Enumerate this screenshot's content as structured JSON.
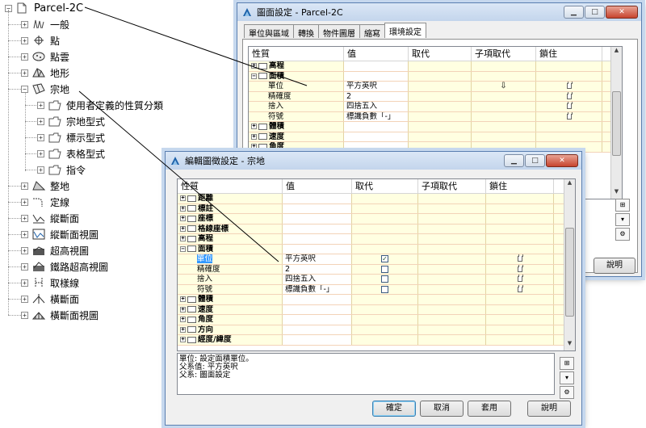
{
  "tree": {
    "root": {
      "label": "Parcel-2C"
    },
    "items": [
      {
        "label": "一般",
        "icon": "general-icon"
      },
      {
        "label": "點",
        "icon": "point-icon"
      },
      {
        "label": "點雲",
        "icon": "point-cloud-icon"
      },
      {
        "label": "地形",
        "icon": "surface-icon"
      },
      {
        "label": "宗地",
        "icon": "parcel-icon",
        "children": [
          {
            "label": "使用者定義的性質分類"
          },
          {
            "label": "宗地型式"
          },
          {
            "label": "標示型式"
          },
          {
            "label": "表格型式"
          },
          {
            "label": "指令"
          }
        ]
      },
      {
        "label": "整地",
        "icon": "grading-icon"
      },
      {
        "label": "定線",
        "icon": "alignment-icon"
      },
      {
        "label": "縱斷面",
        "icon": "profile-icon"
      },
      {
        "label": "縱斷面視圖",
        "icon": "profile-view-icon"
      },
      {
        "label": "超高視圖",
        "icon": "superelevation-view-icon"
      },
      {
        "label": "鐵路超高視圖",
        "icon": "rail-superelevation-icon"
      },
      {
        "label": "取樣線",
        "icon": "sample-line-icon"
      },
      {
        "label": "橫斷面",
        "icon": "section-icon"
      },
      {
        "label": "橫斷面視圖",
        "icon": "section-view-icon"
      }
    ]
  },
  "drawing_settings": {
    "title": "圖面設定 - Parcel-2C",
    "tabs": [
      "單位與區域",
      "轉換",
      "物件圖層",
      "縮寫",
      "環境設定"
    ],
    "active_tab": 4,
    "columns": [
      "性質",
      "值",
      "取代",
      "子項取代",
      "鎖住"
    ],
    "rows": [
      {
        "type": "cat",
        "pm": "+",
        "label": "高程",
        "value": ""
      },
      {
        "type": "cat",
        "pm": "-",
        "label": "面積",
        "value": ""
      },
      {
        "type": "item",
        "label": "單位",
        "value": "平方英呎",
        "child_override": true,
        "lock": true
      },
      {
        "type": "item",
        "label": "精確度",
        "value": "2",
        "lock": true
      },
      {
        "type": "item",
        "label": "捨入",
        "value": "四捨五入",
        "lock": true
      },
      {
        "type": "item",
        "label": "符號",
        "value": "標識負數「-」",
        "lock": true
      },
      {
        "type": "cat",
        "pm": "+",
        "label": "體積",
        "value": ""
      },
      {
        "type": "cat",
        "pm": "+",
        "label": "速度",
        "value": ""
      },
      {
        "type": "cat",
        "pm": "+",
        "label": "角度",
        "value": ""
      }
    ],
    "help_label": "說明"
  },
  "feature_settings": {
    "title": "編輯圖徵設定 - 宗地",
    "columns": [
      "性質",
      "值",
      "取代",
      "子項取代",
      "鎖住"
    ],
    "rows": [
      {
        "type": "cat",
        "pm": "+",
        "label": "距離",
        "value": ""
      },
      {
        "type": "cat",
        "pm": "+",
        "label": "標註",
        "value": ""
      },
      {
        "type": "cat",
        "pm": "+",
        "label": "座標",
        "value": ""
      },
      {
        "type": "cat",
        "pm": "+",
        "label": "格線座標",
        "value": ""
      },
      {
        "type": "cat",
        "pm": "+",
        "label": "高程",
        "value": ""
      },
      {
        "type": "cat",
        "pm": "-",
        "label": "面積",
        "value": ""
      },
      {
        "type": "item",
        "label": "單位",
        "value": "平方英呎",
        "override": true,
        "selected": true
      },
      {
        "type": "item",
        "label": "精確度",
        "value": "2",
        "override": false
      },
      {
        "type": "item",
        "label": "捨入",
        "value": "四捨五入",
        "override": false
      },
      {
        "type": "item",
        "label": "符號",
        "value": "標識負數「-」",
        "override": false
      },
      {
        "type": "cat",
        "pm": "+",
        "label": "體積",
        "value": ""
      },
      {
        "type": "cat",
        "pm": "+",
        "label": "速度",
        "value": ""
      },
      {
        "type": "cat",
        "pm": "+",
        "label": "角度",
        "value": ""
      },
      {
        "type": "cat",
        "pm": "+",
        "label": "方向",
        "value": ""
      },
      {
        "type": "cat",
        "pm": "+",
        "label": "經度/緯度",
        "value": ""
      }
    ],
    "description": [
      "單位: 設定面積單位。",
      "父系值: 平方英呎",
      "父系: 圖面設定"
    ],
    "buttons": {
      "ok": "確定",
      "cancel": "取消",
      "apply": "套用",
      "help": "說明"
    }
  }
}
